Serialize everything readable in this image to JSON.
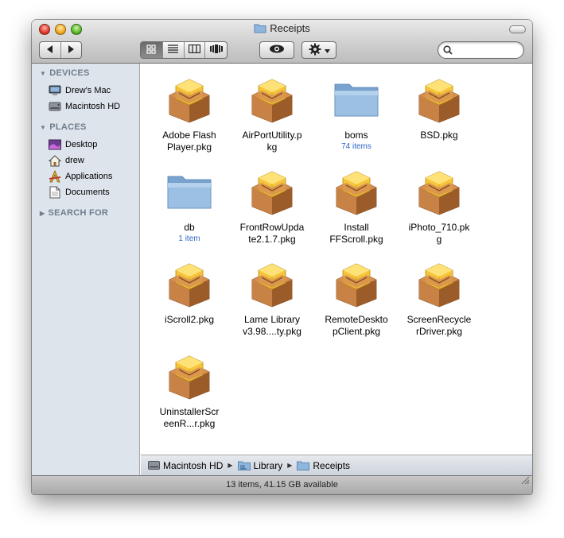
{
  "window": {
    "title": "Receipts",
    "status": "13 items, 41.15 GB available"
  },
  "toolbar": {
    "search": {
      "placeholder": "",
      "value": ""
    },
    "view_modes": [
      "icon",
      "list",
      "column",
      "coverflow"
    ],
    "active_view": "icon"
  },
  "sidebar": {
    "sections": [
      {
        "label": "DEVICES",
        "expanded": true,
        "items": [
          {
            "label": "Drew's Mac",
            "icon": "computer-icon"
          },
          {
            "label": "Macintosh HD",
            "icon": "hard-drive-icon"
          }
        ]
      },
      {
        "label": "PLACES",
        "expanded": true,
        "items": [
          {
            "label": "Desktop",
            "icon": "desktop-icon"
          },
          {
            "label": "drew",
            "icon": "home-icon"
          },
          {
            "label": "Applications",
            "icon": "applications-icon"
          },
          {
            "label": "Documents",
            "icon": "documents-icon"
          }
        ]
      },
      {
        "label": "SEARCH FOR",
        "expanded": false,
        "items": []
      }
    ]
  },
  "items": [
    {
      "name": "Adobe Flash\nPlayer.pkg",
      "type": "package",
      "count": ""
    },
    {
      "name": "AirPortUtility.p\nkg",
      "type": "package",
      "count": ""
    },
    {
      "name": "boms",
      "type": "folder",
      "count": "74 items"
    },
    {
      "name": "BSD.pkg",
      "type": "package",
      "count": ""
    },
    {
      "name": "db",
      "type": "folder",
      "count": "1 item"
    },
    {
      "name": "FrontRowUpda\nte2.1.7.pkg",
      "type": "package",
      "count": ""
    },
    {
      "name": "Install\nFFScroll.pkg",
      "type": "package",
      "count": ""
    },
    {
      "name": "iPhoto_710.pk\ng",
      "type": "package",
      "count": ""
    },
    {
      "name": "iScroll2.pkg",
      "type": "package",
      "count": ""
    },
    {
      "name": "Lame Library\nv3.98....ty.pkg",
      "type": "package",
      "count": ""
    },
    {
      "name": "RemoteDeskto\npClient.pkg",
      "type": "package",
      "count": ""
    },
    {
      "name": "ScreenRecycle\nrDriver.pkg",
      "type": "package",
      "count": ""
    },
    {
      "name": "UninstallerScr\neenR...r.pkg",
      "type": "package",
      "count": ""
    }
  ],
  "path": [
    "Macintosh HD",
    "Library",
    "Receipts"
  ],
  "colors": {
    "sidebar_bg": "#dde4ec",
    "sidebar_header": "#6f7d8c",
    "item_count": "#2f63c6",
    "package": "#b9733a",
    "folder": "#8fb6dc"
  }
}
